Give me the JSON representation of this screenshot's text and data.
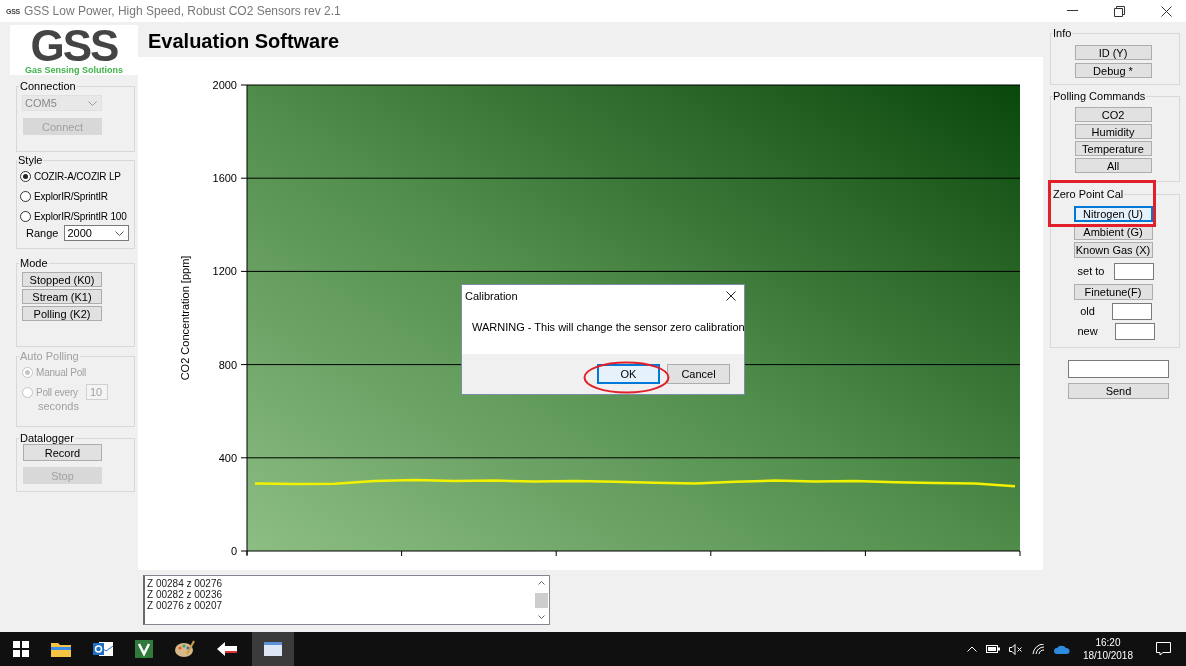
{
  "window": {
    "icon_text": "GSS",
    "title": "GSS Low Power, High Speed, Robust  CO2 Sensors  rev 2.1"
  },
  "logo": {
    "mark": "GSS",
    "tagline": "Gas Sensing Solutions"
  },
  "heading": "Evaluation Software",
  "connection": {
    "title": "Connection",
    "port": "COM5",
    "connect": {
      "label": "Connect",
      "disabled": true
    }
  },
  "style": {
    "title": "Style",
    "options": [
      {
        "label": "COZIR-A/COZIR LP",
        "selected": true
      },
      {
        "label": "ExplorIR/SprintIR",
        "selected": false
      },
      {
        "label": "ExplorIR/SprintIR 100",
        "selected": false
      }
    ],
    "range_label": "Range",
    "range": "2000"
  },
  "mode": {
    "title": "Mode",
    "buttons": [
      "Stopped (K0)",
      "Stream (K1)",
      "Polling (K2)"
    ]
  },
  "auto_polling": {
    "title": "Auto Polling",
    "disabled": true,
    "options": [
      {
        "label": "Manual Poll",
        "selected": true
      },
      {
        "label": "Poll every",
        "selected": false
      }
    ],
    "interval": "10",
    "unit": "seconds"
  },
  "datalogger": {
    "title": "Datalogger",
    "buttons": [
      {
        "label": "Record",
        "disabled": false
      },
      {
        "label": "Stop",
        "disabled": true
      }
    ]
  },
  "chart": {
    "chart_data": {
      "type": "line",
      "ylabel": "CO2 Concentration [ppm]",
      "ylim": [
        0,
        2000
      ],
      "yticks": [
        0,
        400,
        800,
        1200,
        1600,
        2000
      ],
      "grid": true,
      "series": [
        {
          "color": "#f2f200",
          "values": [
            290,
            288,
            289,
            300,
            305,
            300,
            302,
            298,
            300,
            297,
            293,
            290,
            297,
            302,
            298,
            300,
            295,
            292,
            290,
            278
          ]
        }
      ]
    }
  },
  "log": {
    "lines": [
      "Z 00284 z 00276",
      "Z 00282 z 00236",
      "Z 00276 z 00207"
    ]
  },
  "info": {
    "title": "Info",
    "buttons": [
      "ID (Y)",
      "Debug *"
    ]
  },
  "polling_commands": {
    "title": "Polling Commands",
    "buttons": [
      "CO2",
      "Humidity",
      "Temperature",
      "All"
    ]
  },
  "zero_point_cal": {
    "title": "Zero Point Cal",
    "buttons": [
      {
        "label": "Nitrogen (U)",
        "focused": true
      },
      {
        "label": "Ambient (G)",
        "focused": false
      },
      {
        "label": "Known Gas (X)",
        "focused": false
      }
    ],
    "set_to_label": "set to",
    "finetune": "Finetune(F)",
    "old_label": "old",
    "new_label": "new"
  },
  "send": {
    "label": "Send"
  },
  "dialog": {
    "title": "Calibration",
    "message": "WARNING - This will change the sensor zero calibration",
    "buttons": [
      {
        "label": "OK",
        "default": true
      },
      {
        "label": "Cancel",
        "default": false
      }
    ]
  },
  "taskbar": {
    "time": "16:20",
    "date": "18/10/2018"
  }
}
